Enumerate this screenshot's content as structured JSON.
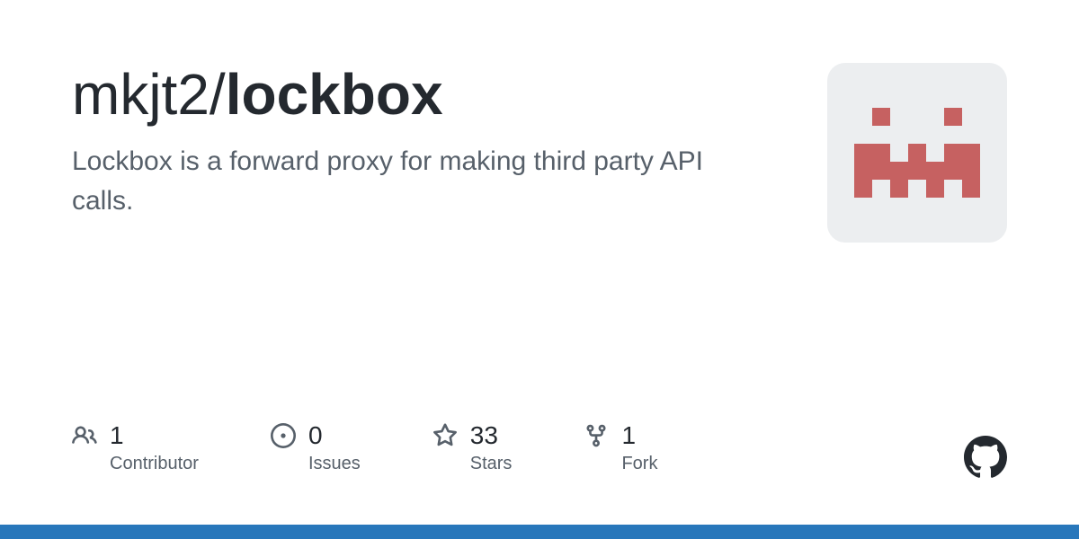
{
  "repo": {
    "owner": "mkjt2",
    "separator": "/",
    "name": "lockbox",
    "description": "Lockbox is a forward proxy for making third party API calls."
  },
  "stats": {
    "contributors": {
      "value": "1",
      "label": "Contributor"
    },
    "issues": {
      "value": "0",
      "label": "Issues"
    },
    "stars": {
      "value": "33",
      "label": "Stars"
    },
    "forks": {
      "value": "1",
      "label": "Fork"
    }
  },
  "colors": {
    "accent": "#2877bb",
    "avatar_bg": "#eceef0",
    "avatar_fg": "#c66161"
  }
}
